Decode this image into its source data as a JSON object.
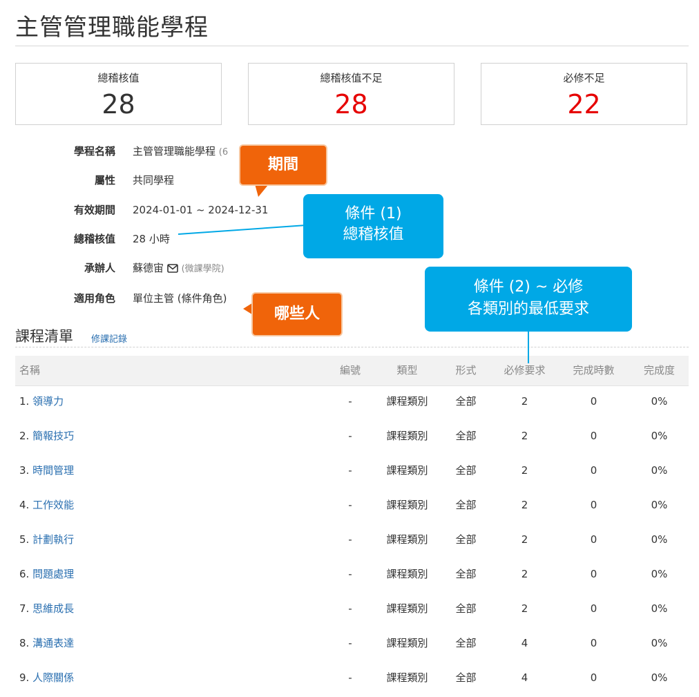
{
  "page": {
    "title": "主管管理職能學程"
  },
  "stats": [
    {
      "label": "總稽核值",
      "value": "28",
      "color": "#333333"
    },
    {
      "label": "總稽核值不足",
      "value": "28",
      "color": "#e60000"
    },
    {
      "label": "必修不足",
      "value": "22",
      "color": "#e60000"
    }
  ],
  "info": {
    "program_name_label": "學程名稱",
    "program_name_value": "主管管理職能學程",
    "program_name_suffix": "(6",
    "attribute_label": "屬性",
    "attribute_value": "共同學程",
    "period_label": "有效期間",
    "period_value": "2024-01-01 ~ 2024-12-31",
    "total_label": "總稽核值",
    "total_value": "28 小時",
    "organizer_label": "承辦人",
    "organizer_value": "蘇德宙",
    "organizer_org": "(微課學院)",
    "role_label": "適用角色",
    "role_value": "單位主管 (條件角色)"
  },
  "course_list": {
    "title": "課程清單",
    "history_link": "修課記錄",
    "columns": [
      "名稱",
      "編號",
      "類型",
      "形式",
      "必修要求",
      "完成時數",
      "完成度"
    ],
    "rows": [
      {
        "index": "1.",
        "name": "領導力",
        "code": "-",
        "type": "課程類別",
        "form": "全部",
        "required": "2",
        "hours": "0",
        "progress": "0%"
      },
      {
        "index": "2.",
        "name": "簡報技巧",
        "code": "-",
        "type": "課程類別",
        "form": "全部",
        "required": "2",
        "hours": "0",
        "progress": "0%"
      },
      {
        "index": "3.",
        "name": "時間管理",
        "code": "-",
        "type": "課程類別",
        "form": "全部",
        "required": "2",
        "hours": "0",
        "progress": "0%"
      },
      {
        "index": "4.",
        "name": "工作效能",
        "code": "-",
        "type": "課程類別",
        "form": "全部",
        "required": "2",
        "hours": "0",
        "progress": "0%"
      },
      {
        "index": "5.",
        "name": "計劃執行",
        "code": "-",
        "type": "課程類別",
        "form": "全部",
        "required": "2",
        "hours": "0",
        "progress": "0%"
      },
      {
        "index": "6.",
        "name": "問題處理",
        "code": "-",
        "type": "課程類別",
        "form": "全部",
        "required": "2",
        "hours": "0",
        "progress": "0%"
      },
      {
        "index": "7.",
        "name": "思維成長",
        "code": "-",
        "type": "課程類別",
        "form": "全部",
        "required": "2",
        "hours": "0",
        "progress": "0%"
      },
      {
        "index": "8.",
        "name": "溝通表達",
        "code": "-",
        "type": "課程類別",
        "form": "全部",
        "required": "4",
        "hours": "0",
        "progress": "0%"
      },
      {
        "index": "9.",
        "name": "人際關係",
        "code": "-",
        "type": "課程類別",
        "form": "全部",
        "required": "4",
        "hours": "0",
        "progress": "0%"
      }
    ]
  },
  "callouts": {
    "period": "期間",
    "who": "哪些人",
    "cond1_line1": "條件 (1)",
    "cond1_line2": "總稽核值",
    "cond2_line1": "條件 (2) ~ 必修",
    "cond2_line2": "各類別的最低要求"
  },
  "colors": {
    "accent_link": "#2a6fb0",
    "warning_red": "#e60000",
    "callout_orange": "#f0640a",
    "callout_blue": "#00a8e6"
  },
  "icons": {
    "organizer_contact": "envelope-icon"
  }
}
